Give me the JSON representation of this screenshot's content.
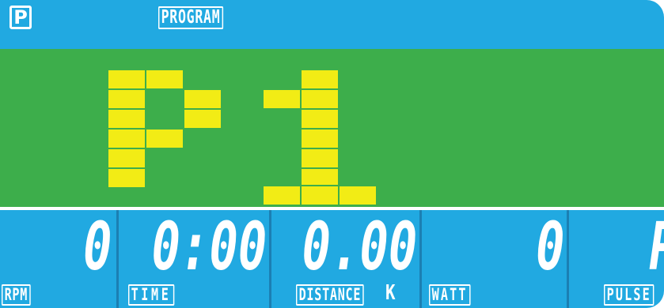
{
  "header": {
    "logo_letter": "P",
    "program_label": "PROGRAM",
    "bg_color": "#21a9e1"
  },
  "main": {
    "program_display": "P1",
    "bg_color": "#3dae4b",
    "segment_color": "#f2ec15"
  },
  "readouts": [
    {
      "value": "0",
      "label": "RPM"
    },
    {
      "value": "0:00",
      "label": "TIME"
    },
    {
      "value": "0.00",
      "label": "DISTANCE",
      "unit": "K"
    },
    {
      "value": "0",
      "label": "WATT"
    },
    {
      "value": "P",
      "label": "PULSE"
    }
  ]
}
